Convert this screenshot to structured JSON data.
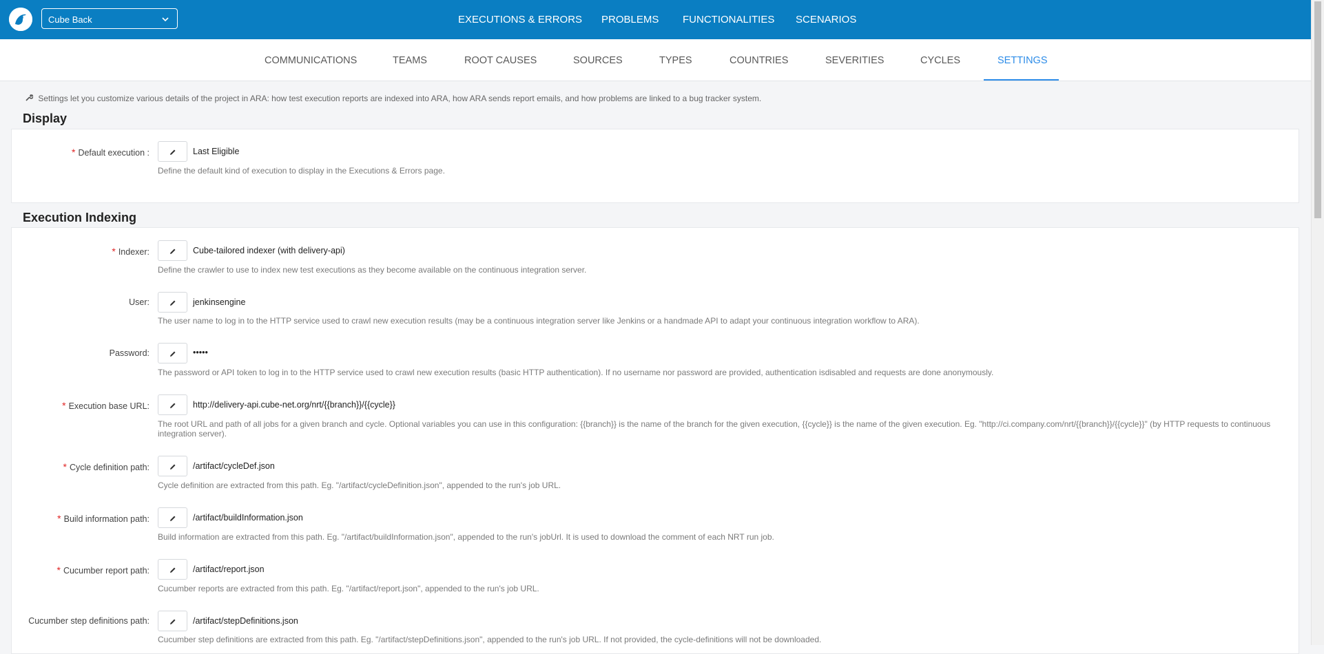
{
  "header": {
    "project": "Cube Back",
    "nav": [
      "EXECUTIONS & ERRORS",
      "PROBLEMS",
      "FUNCTIONALITIES",
      "SCENARIOS"
    ]
  },
  "subnav": {
    "items": [
      "COMMUNICATIONS",
      "TEAMS",
      "ROOT CAUSES",
      "SOURCES",
      "TYPES",
      "COUNTRIES",
      "SEVERITIES",
      "CYCLES",
      "SETTINGS"
    ],
    "active": "SETTINGS"
  },
  "intro": "Settings let you customize various details of the project in ARA: how test execution reports are indexed into ARA, how ARA sends report emails, and how problems are linked to a bug tracker system.",
  "display": {
    "title": "Display",
    "fields": [
      {
        "label": "Default execution :",
        "required": true,
        "value": "Last Eligible",
        "help": "Define the default kind of execution to display in the Executions & Errors page."
      }
    ]
  },
  "indexing": {
    "title": "Execution Indexing",
    "fields": [
      {
        "label": "Indexer:",
        "required": true,
        "value": "Cube-tailored indexer (with delivery-api)",
        "help": "Define the crawler to use to index new test executions as they become available on the continuous integration server."
      },
      {
        "label": "User:",
        "required": false,
        "value": "jenkinsengine",
        "help": "The user name to log in to the HTTP service used to crawl new execution results (may be a continuous integration server like Jenkins or a handmade API to adapt your continuous integration workflow to ARA)."
      },
      {
        "label": "Password:",
        "required": false,
        "value": "•••••",
        "help": "The password or API token to log in to the HTTP service used to crawl new execution results (basic HTTP authentication). If no username nor password are provided, authentication isdisabled and requests are done anonymously."
      },
      {
        "label": "Execution base URL:",
        "required": true,
        "value": "http://delivery-api.cube-net.org/nrt/{{branch}}/{{cycle}}",
        "help": "The root URL and path of all jobs for a given branch and cycle. Optional variables you can use in this configuration: {{branch}} is the name of the branch for the given execution, {{cycle}} is the name of the given execution. Eg. \"http://ci.company.com/nrt/{{branch}}/{{cycle}}\" (by HTTP requests to continuous integration server)."
      },
      {
        "label": "Cycle definition path:",
        "required": true,
        "value": "/artifact/cycleDef.json",
        "help": "Cycle definition are extracted from this path. Eg. \"/artifact/cycleDefinition.json\", appended to the run's job URL."
      },
      {
        "label": "Build information path:",
        "required": true,
        "value": "/artifact/buildInformation.json",
        "help": "Build information are extracted from this path. Eg. \"/artifact/buildInformation.json\", appended to the run's jobUrl. It is used to download the comment of each NRT run job."
      },
      {
        "label": "Cucumber report path:",
        "required": true,
        "value": "/artifact/report.json",
        "help": "Cucumber reports are extracted from this path. Eg. \"/artifact/report.json\", appended to the run's job URL."
      },
      {
        "label": "Cucumber step definitions path:",
        "required": false,
        "value": "/artifact/stepDefinitions.json",
        "help": "Cucumber step definitions are extracted from this path. Eg. \"/artifact/stepDefinitions.json\", appended to the run's job URL. If not provided, the cycle-definitions will not be downloaded."
      }
    ]
  },
  "icons": {
    "logo": "ara-logo-icon",
    "edit": "pencil-icon",
    "dropdown": "chevron-down-icon",
    "intro": "wrench-icon"
  },
  "colors": {
    "topbar": "#0a7ec2",
    "active_tab": "#2d8ce8",
    "required": "#e02424"
  }
}
